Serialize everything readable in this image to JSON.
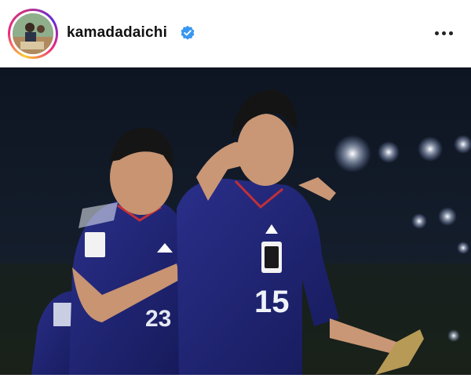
{
  "post": {
    "username": "kamadadaichi",
    "verified": true,
    "more_icon": "ellipsis-horizontal-icon",
    "verified_icon": "verified-badge-icon",
    "accent_colors": {
      "verified": "#3897f0",
      "story_ring": [
        "#f9ce34",
        "#ee2a7b",
        "#6228d7"
      ]
    }
  },
  "photo": {
    "jersey_number_center": "15",
    "jersey_number_left": "23"
  }
}
